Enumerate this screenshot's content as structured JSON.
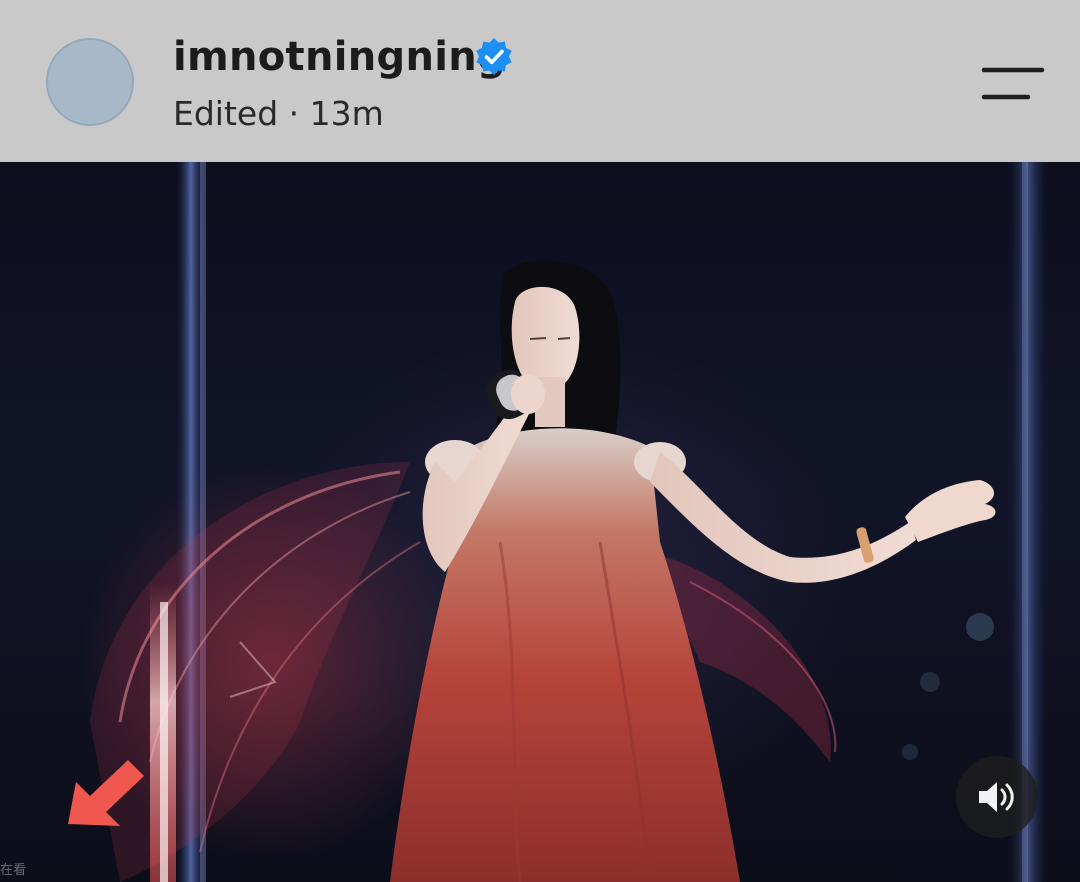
{
  "post": {
    "username": "imnotningning",
    "meta": "Edited · 13m",
    "verified": true
  },
  "video": {
    "overlay_caption": "在看",
    "sound_icon": "speaker-volume-icon"
  },
  "icons": {
    "menu": "hamburger-menu-icon",
    "verified": "verified-badge-icon",
    "arrow": "arrow-down-left-icon"
  },
  "colors": {
    "header_bg": "#c9c9c9",
    "verified_blue": "#1d8ff2",
    "arrow_red": "#f0574f",
    "dress_red": "#b5443a"
  }
}
